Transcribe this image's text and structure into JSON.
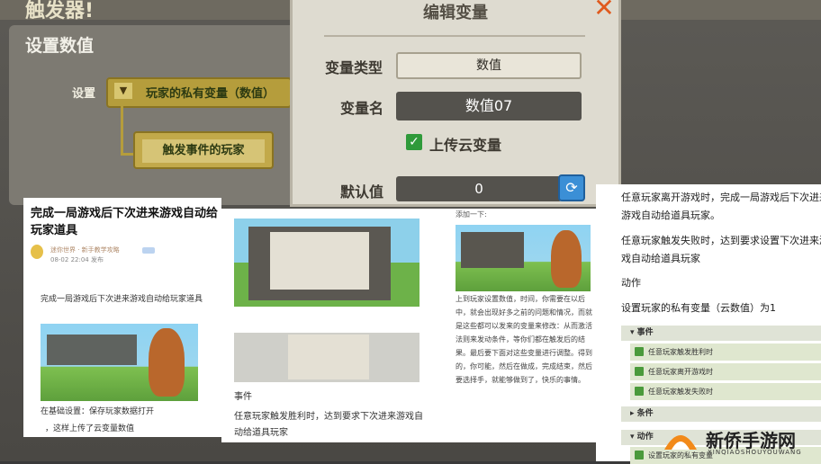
{
  "background": {
    "title": "触发器!",
    "heading": "设置数值",
    "set_label": "设置",
    "select_arrow": "▼",
    "select_value": "玩家的私有变量（数值）",
    "trigger_player": "触发事件的玩家"
  },
  "dialog": {
    "title": "编辑变量",
    "close_icon": "close-icon",
    "type_label": "变量类型",
    "type_value": "数值",
    "name_label": "变量名",
    "name_value": "数值07",
    "cloud_checked": true,
    "cloud_label": "上传云变量",
    "default_label": "默认值",
    "default_value": "0",
    "refresh_icon": "refresh-icon"
  },
  "card1": {
    "title": "完成一局游戏后下次进来游戏自动给玩家道具",
    "author": "迷你世界 · 新手教学攻略",
    "date": "08-02 22:04 发布",
    "body": "完成一局游戏后下次进来游戏自动给玩家道具",
    "caption1": "在基础设置：保存玩家数据打开",
    "caption2": "，这样上传了云变量数值"
  },
  "card2": {
    "event": "事件",
    "body": "任意玩家触发胜利时，达到要求下次进来游戏自动给道具玩家"
  },
  "card3": {
    "top": "添加一下:",
    "body": "上到玩家设置数值，时间，你需要在以后中，就会出现好多之前的问题和情况，而就是这些都可以发来的变量来修改：从而激活法则来发动条件，等你们都在触发后的结果。最后要下面对这些变量进行调整。得到的，你可能，然后在做成，完成结束，然后要选择手，就能够做到了，快乐的事情。"
  },
  "right_panel": {
    "p1": "任意玩家离开游戏时，完成一局游戏后下次进来游戏自动给道具玩家。",
    "p2": "任意玩家触发失败时，达到要求设置下次进来游戏自动给道具玩家",
    "action": "动作",
    "p3": "设置玩家的私有变量（云数值）为1",
    "event_header": "▾ 事件",
    "event_items": [
      "任意玩家触发胜利时",
      "任意玩家离开游戏时",
      "任意玩家触发失败时"
    ],
    "condition_header": "▸ 条件",
    "action_header": "▾ 动作",
    "action_item": "设置玩家的私有变量"
  },
  "watermark": {
    "name": "新侨手游网",
    "sub": "XINQIAOSHOUYOUWANG"
  },
  "colors": {
    "accent_orange": "#e05a1e",
    "check_green": "#2f9a3a",
    "refresh_blue": "#3b8fd6",
    "select_gold": "#b59d3c"
  }
}
